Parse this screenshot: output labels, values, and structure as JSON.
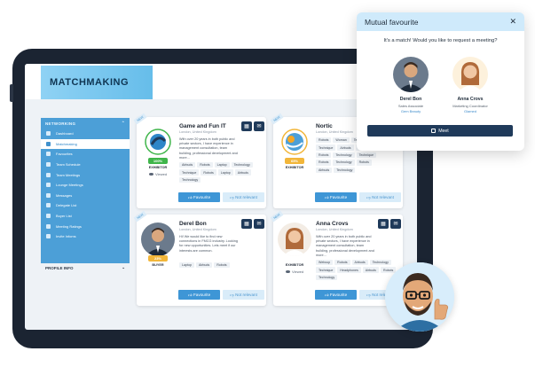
{
  "app": {
    "title": "MATCHMAKING"
  },
  "sidebar": {
    "section_label": "NETWORKING",
    "items": [
      {
        "label": "Dashboard"
      },
      {
        "label": "Matchmaking",
        "active": true
      },
      {
        "label": "Favourites"
      },
      {
        "label": "Team Schedule"
      },
      {
        "label": "Team Meetings"
      },
      {
        "label": "Lounge Meetings"
      },
      {
        "label": "Messages"
      },
      {
        "label": "Delegate List"
      },
      {
        "label": "Buyer List"
      },
      {
        "label": "Meeting Ratings"
      },
      {
        "label": "Invite Infoms"
      }
    ],
    "profile_label": "PROFILE INFO"
  },
  "cards": [
    {
      "name": "Game and Fun IT",
      "location": "London, United Kingdom",
      "bio": "With over 20 years in both public and private sectors, I have experience in management consultation, team building, professional development and more...",
      "ribbon": "NEW",
      "match_pct": "100%",
      "match_color": "#3fb54a",
      "role": "EXHIBITOR",
      "viewed_label": "Viewed",
      "tags": [
        "Airbuds",
        "Robots",
        "Laptop",
        "Technology",
        "Technique",
        "Robots",
        "Laptop",
        "Airbuds",
        "Technology"
      ],
      "favourite_label": "Favourite",
      "not_relevant_label": "Not relevant"
    },
    {
      "name": "Nortic",
      "location": "London, United Kingdom",
      "bio": "",
      "ribbon": "NEW",
      "match_pct": "65%",
      "match_color": "#f2b63a",
      "role": "EXHIBITOR",
      "viewed_label": "",
      "tags": [
        "Robots",
        "Woman",
        "Technology",
        "Technique",
        "Airbuds",
        "Airbuds",
        "Robots",
        "Technology",
        "Technique",
        "Robots",
        "Technology",
        "Robots",
        "Airbuds",
        "Technology"
      ],
      "favourite_label": "Favourite",
      "not_relevant_label": "Not relevant"
    },
    {
      "name": "Derel Bon",
      "location": "London, United Kingdom",
      "bio": "Hi! We would like to find new connections in FMCG industry. Looking for new opportunities. Lets meet if our interests are common.",
      "ribbon": "NEW",
      "match_pct": "23%",
      "match_color": "#f2b63a",
      "role": "BUYER",
      "viewed_label": "",
      "tags": [
        "Laptop",
        "Airbuds",
        "Robots"
      ],
      "favourite_label": "Favourite",
      "not_relevant_label": "Not relevant"
    },
    {
      "name": "Anna Crovs",
      "location": "London, United Kingdom",
      "bio": "With over 20 years in both public and private sectors, I have experience in management consultation, team building, professional development and more...",
      "ribbon": "NEW",
      "match_pct": "",
      "match_color": "#3fb54a",
      "role": "EXHIBITOR",
      "viewed_label": "Viewed",
      "tags": [
        "Webcup",
        "Robots",
        "Airbuds",
        "Technology",
        "Technique",
        "Headphones",
        "Airbuds",
        "Robots",
        "Technology"
      ],
      "favourite_label": "Favourite",
      "not_relevant_label": "Not relevant"
    }
  ],
  "popup": {
    "title": "Mutual favourite",
    "close_glyph": "✕",
    "question": "It's a match! Would you like to request a meeting?",
    "person_a": {
      "name": "Derel Bon",
      "role": "Sales Associate",
      "company": "Gem Beauty"
    },
    "person_b": {
      "name": "Anna Crovs",
      "role": "Marketing Coordinator",
      "company": "Glamed"
    },
    "meet_label": "Meet"
  },
  "icons": {
    "calendar": "calendar-icon",
    "message": "mail-icon",
    "thumbs_up": "thumbs-up-icon",
    "thumbs_down": "thumbs-down-icon",
    "eye": "eye-icon",
    "close": "close-icon"
  },
  "colors": {
    "accent": "#3e96d6",
    "sidebar": "#4c9fd7",
    "dark_button": "#1f3a5a",
    "popup_header": "#cfeafb"
  }
}
